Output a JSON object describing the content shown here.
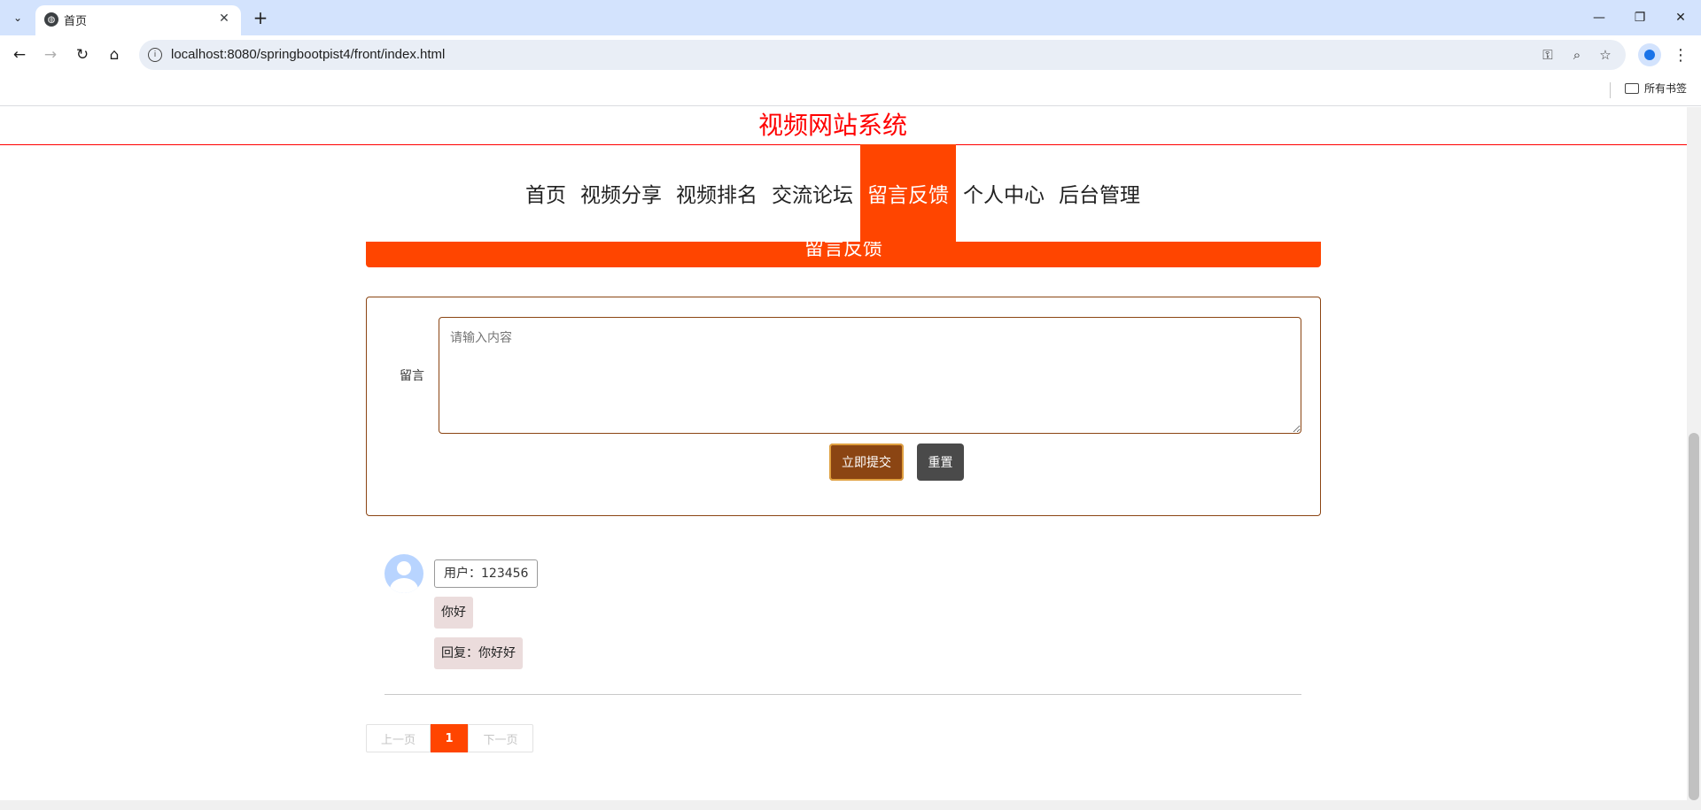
{
  "browser": {
    "tab_title": "首页",
    "url": "localhost:8080/springbootpist4/front/index.html",
    "bookmark_folder": "所有书签"
  },
  "site": {
    "title": "视频网站系统",
    "nav": [
      "首页",
      "视频分享",
      "视频排名",
      "交流论坛",
      "留言反馈",
      "个人中心",
      "后台管理"
    ],
    "active_nav": "留言反馈",
    "banner_title": "留言反馈"
  },
  "form": {
    "label": "留言",
    "placeholder": "请输入内容",
    "submit_label": "立即提交",
    "reset_label": "重置"
  },
  "messages": [
    {
      "user": "用户：123456",
      "content": "你好",
      "reply": "回复：你好好"
    }
  ],
  "pager": {
    "prev": "上一页",
    "current": "1",
    "next": "下一页"
  },
  "colors": {
    "accent": "#ff4500",
    "title": "#ff0000",
    "brown": "#8b4513"
  }
}
